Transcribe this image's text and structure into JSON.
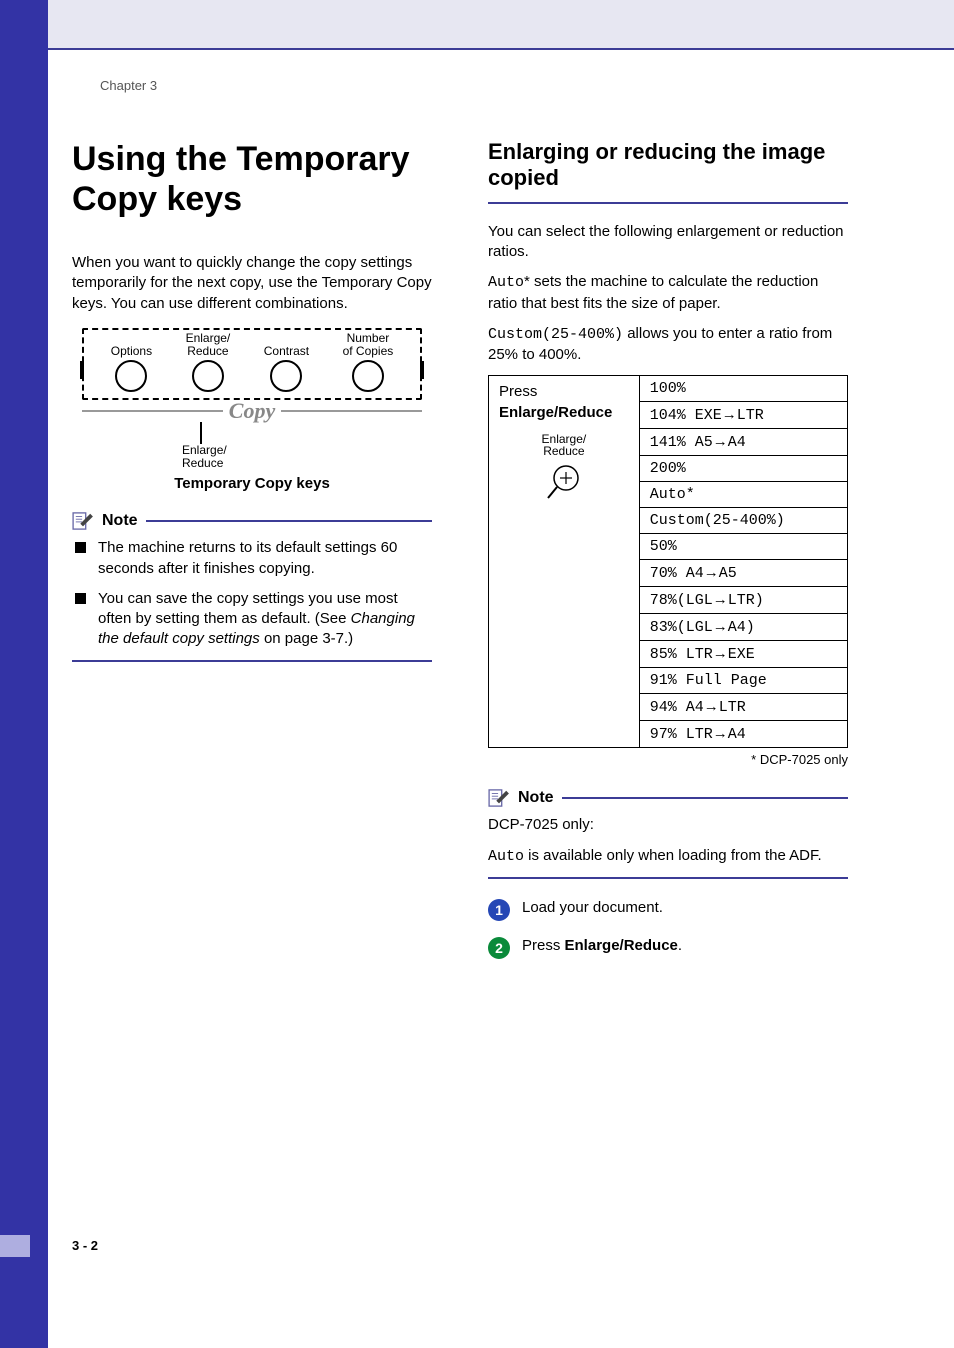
{
  "chapter": "Chapter 3",
  "page_number": "3 - 2",
  "left": {
    "heading": "Using the Temporary Copy keys",
    "intro": "When you want to quickly change the copy settings temporarily for the next copy, use the Temporary Copy keys. You can use different combinations.",
    "diagram": {
      "options": "Options",
      "enlarge_reduce": "Enlarge/\nReduce",
      "contrast": "Contrast",
      "num_copies": "Number\nof Copies",
      "copy": "Copy",
      "pointer_label": "Enlarge/\nReduce",
      "caption": "Temporary Copy keys"
    },
    "note_label": "Note",
    "notes": [
      "The machine returns to its default settings 60 seconds after it finishes copying.",
      "You can save the copy settings you use most often by setting them as default. (See Changing the default copy settings on page 3-7.)"
    ]
  },
  "right": {
    "heading": "Enlarging or reducing the image copied",
    "p1": "You can select the following enlargement or reduction ratios.",
    "p2_code": "Auto",
    "p2_rest": "* sets the machine to calculate the reduction ratio that best fits the size of paper.",
    "p3_code": "Custom(25-400%)",
    "p3_rest": " allows you to enter a ratio from 25% to 400%.",
    "table": {
      "left_press": "Press",
      "left_bold": "Enlarge/Reduce",
      "left_graphic_label": "Enlarge/\nReduce",
      "rows": [
        "100%",
        "104% EXE→LTR",
        "141% A5→A4",
        "200%",
        "Auto*",
        "Custom(25-400%)",
        "50%",
        "70% A4→A5",
        "78%(LGL→LTR)",
        "83%(LGL→A4)",
        "85% LTR→EXE",
        "91% Full Page",
        "94% A4→LTR",
        "97% LTR→A4"
      ],
      "footnote": "* DCP-7025 only"
    },
    "note_label": "Note",
    "note_lines": {
      "l1": "DCP-7025 only:",
      "l2_code": "Auto",
      "l2_rest": " is available only when loading from the ADF."
    },
    "steps": [
      "Load your document.",
      "Press Enlarge/Reduce."
    ],
    "step2_prefix": "Press ",
    "step2_bold": "Enlarge/Reduce",
    "step2_suffix": "."
  }
}
